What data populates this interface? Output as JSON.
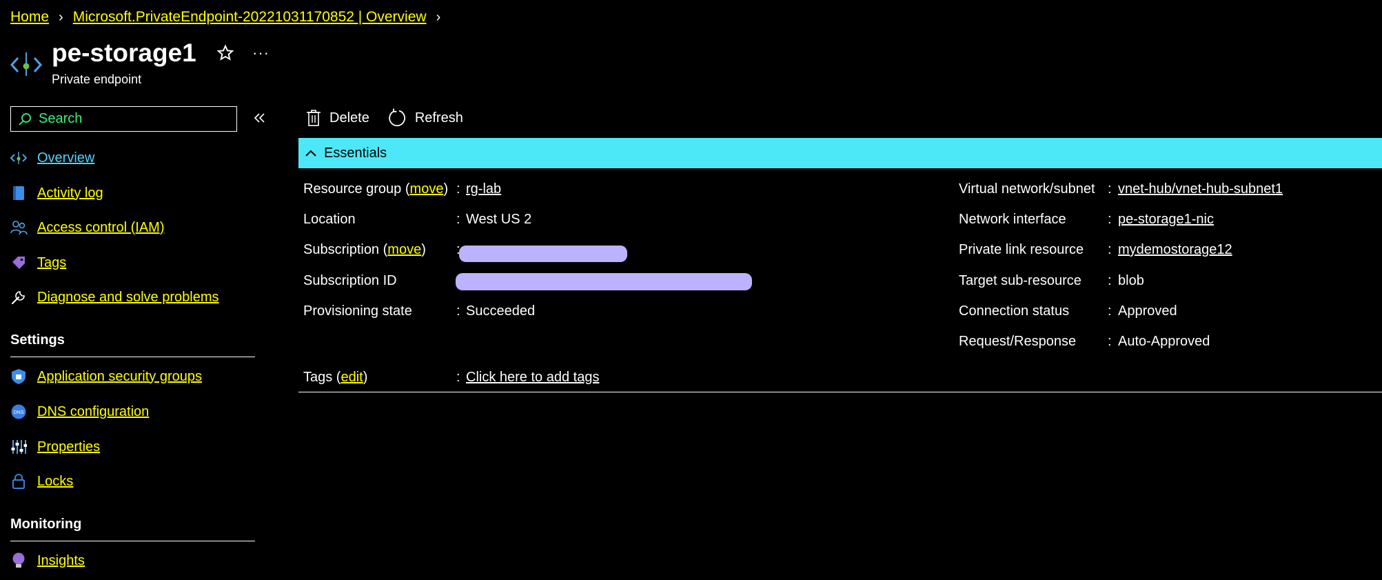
{
  "breadcrumb": {
    "home": "Home",
    "deployment": "Microsoft.PrivateEndpoint-20221031170852 | Overview"
  },
  "header": {
    "title": "pe-storage1",
    "subtitle": "Private endpoint",
    "more": "···"
  },
  "sidebar": {
    "search_placeholder": "Search",
    "items": [
      {
        "label": "Overview",
        "icon": "private-endpoint-icon"
      },
      {
        "label": "Activity log",
        "icon": "activity-log-icon"
      },
      {
        "label": "Access control (IAM)",
        "icon": "people-icon"
      },
      {
        "label": "Tags",
        "icon": "tag-icon"
      },
      {
        "label": "Diagnose and solve problems",
        "icon": "wrench-icon"
      }
    ],
    "settings": {
      "heading": "Settings",
      "items": [
        {
          "label": "Application security groups",
          "icon": "shield-icon"
        },
        {
          "label": "DNS configuration",
          "icon": "dns-icon"
        },
        {
          "label": "Properties",
          "icon": "properties-icon"
        },
        {
          "label": "Locks",
          "icon": "lock-icon"
        }
      ]
    },
    "monitoring": {
      "heading": "Monitoring",
      "items": [
        {
          "label": "Insights",
          "icon": "lightbulb-icon"
        }
      ]
    }
  },
  "toolbar": {
    "delete_label": "Delete",
    "refresh_label": "Refresh"
  },
  "essentials": {
    "title": "Essentials",
    "left": {
      "resource_group_label": "Resource group (",
      "move_link": "move",
      "close_paren": ")",
      "resource_group_value": "rg-lab",
      "location_label": "Location",
      "location_value": "West US 2",
      "subscription_label": "Subscription (",
      "subscription_move_link": "move",
      "subscription_id_label": "Subscription ID",
      "provisioning_label": "Provisioning state",
      "provisioning_value": "Succeeded"
    },
    "right": {
      "vnet_label": "Virtual network/subnet",
      "vnet_value": "vnet-hub/vnet-hub-subnet1",
      "nic_label": "Network interface",
      "nic_value": "pe-storage1-nic",
      "plr_label": "Private link resource",
      "plr_value": "mydemostorage12",
      "target_label": "Target sub-resource",
      "target_value": "blob",
      "conn_label": "Connection status",
      "conn_value": "Approved",
      "req_label": "Request/Response",
      "req_value": "Auto-Approved"
    },
    "tags": {
      "label_open": "Tags (",
      "edit_link": "edit",
      "label_close": ")",
      "value": "Click here to add tags"
    },
    "colon": ":"
  },
  "colors": {
    "link": "#ffff00",
    "selected": "#4fd4ff",
    "essentials_bar": "#4de8f8",
    "search_text": "#3bf07a",
    "redaction": "#bbb3ff"
  }
}
